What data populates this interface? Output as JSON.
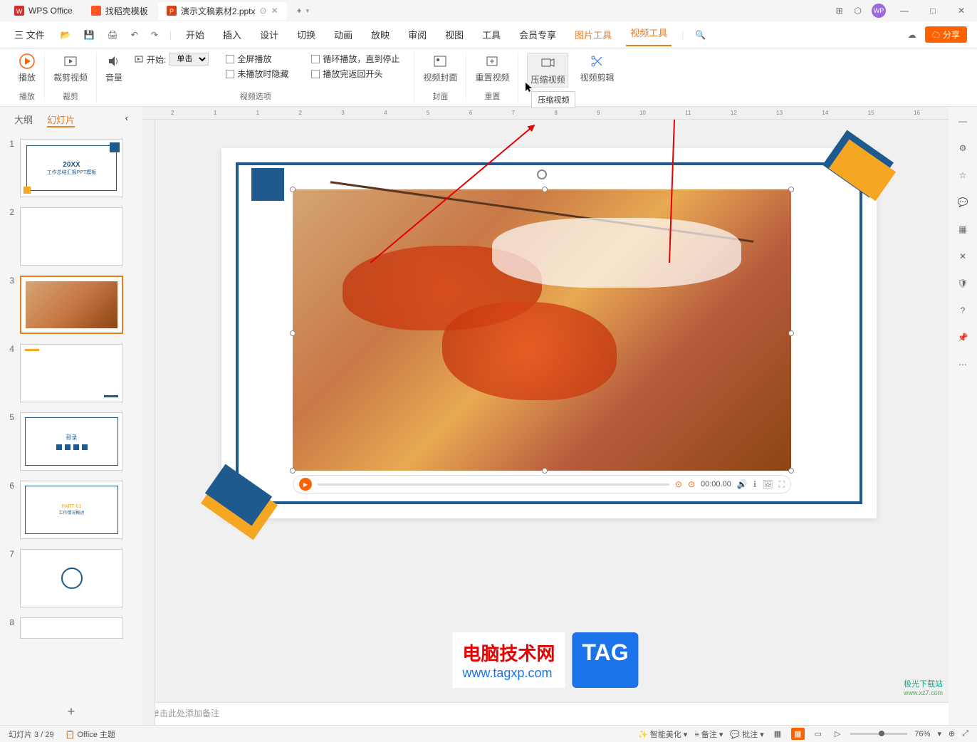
{
  "titleBar": {
    "tabs": [
      {
        "icon": "wps",
        "label": "WPS Office"
      },
      {
        "icon": "doc",
        "label": "找稻壳模板"
      },
      {
        "icon": "ppt",
        "label": "演示文稿素材2.pptx",
        "active": true,
        "hasClose": true
      }
    ],
    "addTab": "+",
    "avatar": "WP"
  },
  "menuBar": {
    "fileMenu": "三 文件",
    "items": [
      "开始",
      "插入",
      "设计",
      "切换",
      "动画",
      "放映",
      "审阅",
      "视图",
      "工具",
      "会员专享"
    ],
    "contextItems": [
      "图片工具",
      "视频工具"
    ],
    "activeContext": "视频工具",
    "share": "分享"
  },
  "ribbon": {
    "play": {
      "btn": "播放",
      "label": "播放"
    },
    "trim": {
      "btn": "裁剪视频",
      "label": "裁剪"
    },
    "volume": "音量",
    "startLabel": "开始:",
    "startValue": "单击",
    "opts": {
      "fullscreen": "全屏播放",
      "hideWhenNot": "未播放时隐藏",
      "loop": "循环播放，直到停止",
      "rewind": "播放完返回开头"
    },
    "optionsLabel": "视频选项",
    "cover": {
      "btn": "视频封面",
      "label": "封面"
    },
    "reset": {
      "btn": "重置视频",
      "label": "重置"
    },
    "compress": "压缩视频",
    "edit": "视频剪辑",
    "tooltip": "压缩视频"
  },
  "leftPanel": {
    "tabs": [
      "大纲",
      "幻灯片"
    ],
    "activeTab": "幻灯片",
    "slideCount": 8,
    "selectedSlide": 3,
    "slide1": {
      "year": "20XX",
      "title": "工作总结汇报PPT模板"
    },
    "slide5": {
      "title": "目录"
    },
    "slide6": {
      "part": "PART 01",
      "sub": "工作情况概述"
    }
  },
  "canvas": {
    "rulerMarks": [
      "2",
      "1",
      "1",
      "2",
      "3",
      "4",
      "5",
      "6",
      "7",
      "8",
      "9",
      "10",
      "11",
      "12",
      "13",
      "14",
      "15",
      "16"
    ],
    "videoTime": "00:00.00",
    "notesPlaceholder": "单击此处添加备注"
  },
  "watermark": {
    "title": "电脑技术网",
    "url": "www.tagxp.com",
    "tag": "TAG",
    "logo": "极光下载站",
    "logoUrl": "www.xz7.com"
  },
  "statusBar": {
    "slideInfo": "幻灯片 3 / 29",
    "theme": "Office 主题",
    "beautify": "智能美化",
    "notes": "备注",
    "comments": "批注",
    "zoom": "76%"
  }
}
